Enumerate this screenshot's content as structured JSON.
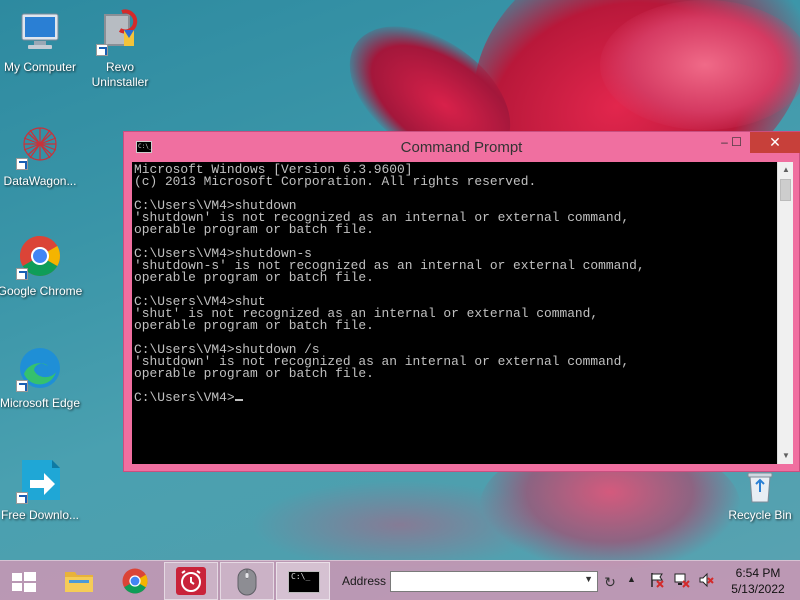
{
  "desktop": {
    "icons": [
      {
        "label": "My Computer",
        "icon": "my-computer-icon"
      },
      {
        "label": "Revo Uninstaller",
        "icon": "revo-uninstaller-icon"
      },
      {
        "label": "DataWagon...",
        "icon": "datawagon-icon"
      },
      {
        "label": "Google Chrome",
        "icon": "chrome-icon"
      },
      {
        "label": "Microsoft Edge",
        "icon": "edge-icon"
      },
      {
        "label": "Free Downlo...",
        "icon": "free-download-icon"
      },
      {
        "label": "Recycle Bin",
        "icon": "recycle-bin-icon"
      }
    ]
  },
  "cmd": {
    "title": "Command Prompt",
    "app_icon_text": "C:\\_",
    "lines": [
      "Microsoft Windows [Version 6.3.9600]",
      "(c) 2013 Microsoft Corporation. All rights reserved.",
      "",
      "C:\\Users\\VM4>shutdown",
      "'shutdown' is not recognized as an internal or external command,",
      "operable program or batch file.",
      "",
      "C:\\Users\\VM4>shutdown-s",
      "'shutdown-s' is not recognized as an internal or external command,",
      "operable program or batch file.",
      "",
      "C:\\Users\\VM4>shut",
      "'shut' is not recognized as an internal or external command,",
      "operable program or batch file.",
      "",
      "C:\\Users\\VM4>shutdown /s",
      "'shutdown' is not recognized as an internal or external command,",
      "operable program or batch file.",
      "",
      "C:\\Users\\VM4>"
    ],
    "min_glyph": "–",
    "max_glyph": "☐",
    "close_glyph": "✕",
    "scroll_up": "▲",
    "scroll_down": "▼"
  },
  "taskbar": {
    "address_label": "Address",
    "address_value": "",
    "dropdown_glyph": "▼",
    "refresh_glyph": "↻",
    "tray_up_glyph": "▲",
    "time": "6:54 PM",
    "date": "5/13/2022",
    "pinned": [
      "file-explorer-icon",
      "chrome-icon",
      "alarm-clock-icon",
      "mouse-icon",
      "cmd-icon"
    ]
  }
}
